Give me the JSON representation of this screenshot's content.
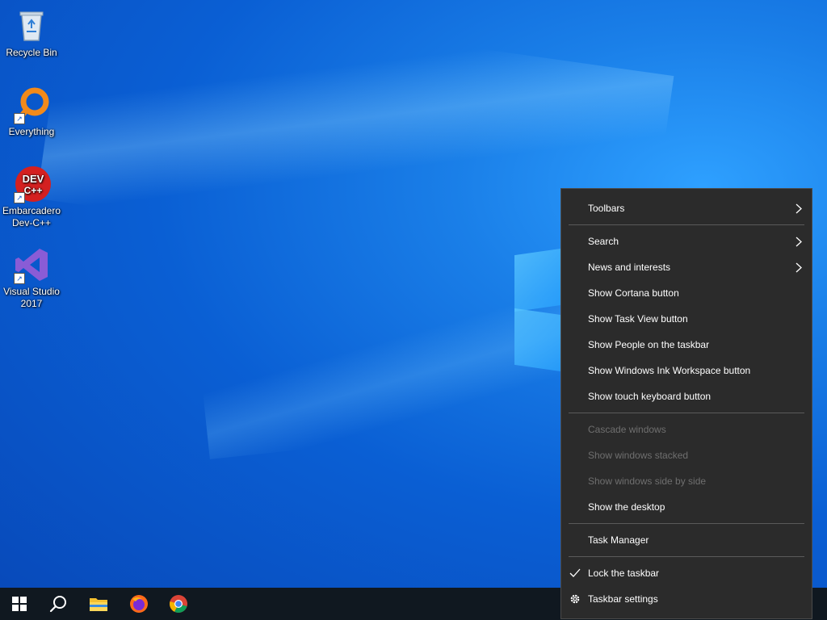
{
  "desktop": {
    "icons": [
      {
        "label": "Recycle Bin"
      },
      {
        "label": "Everything"
      },
      {
        "label": "Embarcadero Dev-C++"
      },
      {
        "label": "Visual Studio 2017"
      }
    ]
  },
  "context_menu": {
    "items": [
      {
        "label": "Toolbars",
        "submenu": true
      },
      {
        "label": "Search",
        "submenu": true
      },
      {
        "label": "News and interests",
        "submenu": true
      },
      {
        "label": "Show Cortana button"
      },
      {
        "label": "Show Task View button"
      },
      {
        "label": "Show People on the taskbar"
      },
      {
        "label": "Show Windows Ink Workspace button"
      },
      {
        "label": "Show touch keyboard button"
      },
      {
        "label": "Cascade windows",
        "disabled": true
      },
      {
        "label": "Show windows stacked",
        "disabled": true
      },
      {
        "label": "Show windows side by side",
        "disabled": true
      },
      {
        "label": "Show the desktop"
      },
      {
        "label": "Task Manager"
      },
      {
        "label": "Lock the taskbar",
        "checked": true
      },
      {
        "label": "Taskbar settings",
        "icon": "gear-icon"
      }
    ]
  },
  "taskbar": {
    "buttons": [
      {
        "icon": "windows-start-icon"
      },
      {
        "icon": "search-icon"
      },
      {
        "icon": "file-explorer-icon"
      },
      {
        "icon": "firefox-icon"
      },
      {
        "icon": "chrome-icon"
      }
    ]
  },
  "colors": {
    "menu_bg": "#2b2b2b",
    "disabled_text": "#6f6f6f",
    "taskbar_bg": "#101820"
  }
}
